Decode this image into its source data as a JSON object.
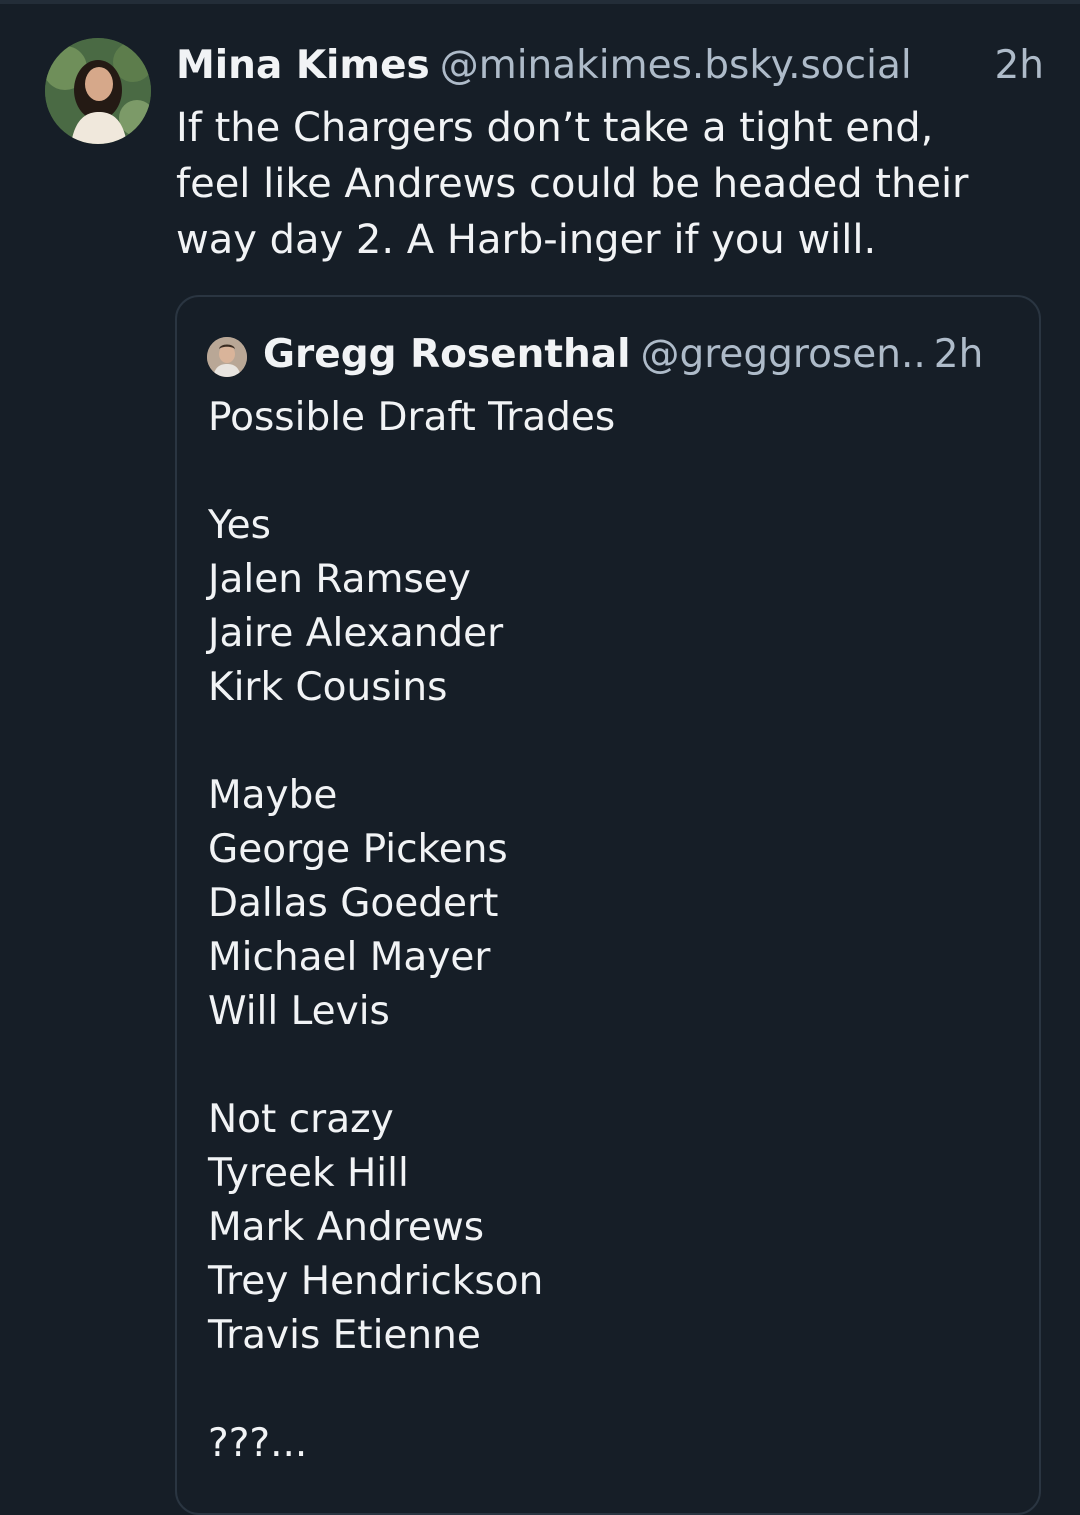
{
  "post": {
    "author_name": "Mina Kimes",
    "author_handle": "@minakimes.bsky.social",
    "timestamp": "2h",
    "text": "If the Chargers don’t take a tight end,\nfeel like Andrews could be headed their\nway day 2. A Harb-inger if you will.",
    "avatar_icon": "user-avatar"
  },
  "quote": {
    "author_name": "Gregg Rosenthal",
    "author_handle": "@greggrosen..",
    "timestamp": "2h",
    "avatar_icon": "user-avatar",
    "title": "Possible Draft Trades",
    "groups": [
      {
        "heading": "Yes",
        "items": [
          "Jalen Ramsey",
          "Jaire Alexander",
          "Kirk Cousins"
        ]
      },
      {
        "heading": "Maybe",
        "items": [
          "George Pickens",
          "Dallas Goedert",
          "Michael Mayer",
          "Will Levis"
        ]
      },
      {
        "heading": "Not crazy",
        "items": [
          "Tyreek Hill",
          "Mark Andrews",
          "Trey Hendrickson",
          "Travis Etienne"
        ]
      }
    ],
    "footer": "???..."
  },
  "colors": {
    "background": "#161e27",
    "text": "#f1f3f5",
    "muted": "#aebbc9",
    "border": "#2a3541"
  }
}
